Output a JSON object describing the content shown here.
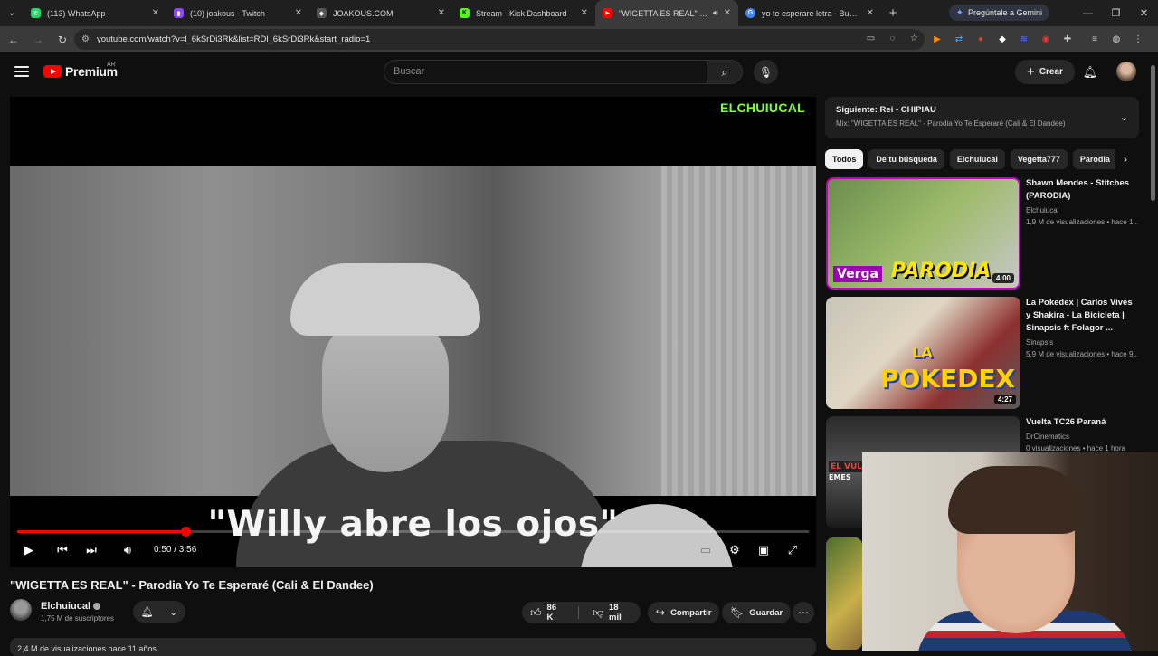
{
  "browser": {
    "tabs": [
      {
        "title": "(113) WhatsApp",
        "fav_color": "#25d366",
        "fav_glyph": "✆",
        "active": false
      },
      {
        "title": "(10) joakous - Twitch",
        "fav_color": "#9146ff",
        "fav_glyph": "▮",
        "active": false
      },
      {
        "title": "JOAKOUS.COM",
        "fav_color": "#555555",
        "fav_glyph": "◆",
        "active": false
      },
      {
        "title": "Stream - Kick Dashboard",
        "fav_color": "#53fc18",
        "fav_glyph": "K",
        "active": false
      },
      {
        "title": "\"WIGETTA ES REAL\" - Parod",
        "fav_color": "#ff0000",
        "fav_glyph": "▶",
        "active": true
      },
      {
        "title": "yo te esperare letra - Buscar co",
        "fav_color": "#4285f4",
        "fav_glyph": "G",
        "active": false
      }
    ],
    "gemini_label": "Pregúntale a Gemini",
    "url": "youtube.com/watch?v=l_6kSrDi3Rk&list=RDl_6kSrDi3Rk&start_radio=1"
  },
  "youtube": {
    "logo_text": "Premium",
    "country": "AR",
    "search_placeholder": "Buscar",
    "create_label": "Crear"
  },
  "player": {
    "watermark": "ELCHUIUCAL",
    "caption": "\"Willy abre los ojos\"",
    "current_time": "0:50",
    "duration": "3:56",
    "time_display": "0:50 / 3:56",
    "progress_fraction": 0.212
  },
  "video": {
    "title": "\"WIGETTA ES REAL\" - Parodia Yo Te Esperaré (Cali & El Dandee)",
    "channel": "Elchuiucal",
    "subscribers": "1,75 M de suscriptores",
    "likes": "86 K",
    "dislikes": "18 mil",
    "share_label": "Compartir",
    "save_label": "Guardar",
    "views_line": "2,4 M de visualizaciones  hace 11 años"
  },
  "sidebar": {
    "playlist_next": "Siguiente: Rei - CHIPIAU",
    "playlist_mix": "Mix: \"WIGETTA ES REAL\" - Parodia Yo Te Esperaré (Cali & El Dandee)",
    "chips": [
      "Todos",
      "De tu búsqueda",
      "Elchuiucal",
      "Vegetta777",
      "Parodia"
    ],
    "recommendations": [
      {
        "title": "Shawn Mendes - Stitches (PARODIA)",
        "channel": "Elchuiucal",
        "views": "1,9 M de visualizaciones • hace 1...",
        "duration": "4:00",
        "thumb_text_1": "Verga",
        "thumb_text_2": "PARODIA"
      },
      {
        "title": "La Pokedex | Carlos Vives y Shakira - La Bicicleta | Sinapsis ft Folagor ...",
        "channel": "Sinapsis",
        "views": "5,9 M de visualizaciones • hace 9...",
        "duration": "4:27",
        "thumb_text_1": "LA",
        "thumb_text_2": "POKEDEX"
      },
      {
        "title": "Vuelta TC26 Paraná",
        "channel": "DrCinematics",
        "views": "0 visualizaciones • hace 1 hora",
        "duration": "",
        "thumb_text_1": "EL VULL",
        "thumb_text_2": "EMES"
      }
    ]
  },
  "colors": {
    "accent": "#ff0000",
    "watermark": "#7cff3a",
    "background": "#0f0f0f"
  }
}
